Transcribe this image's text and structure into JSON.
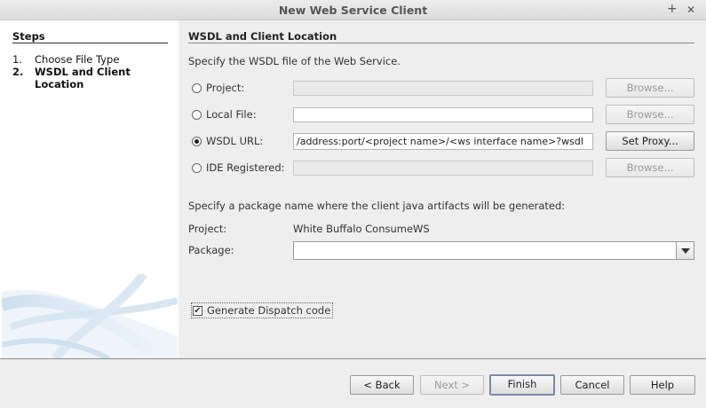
{
  "window": {
    "title": "New Web Service Client",
    "maximize_glyph": "+",
    "close_glyph": "✕"
  },
  "steps": {
    "heading": "Steps",
    "items": [
      {
        "num": "1.",
        "label": "Choose File Type",
        "active": false
      },
      {
        "num": "2.",
        "label": "WSDL and Client Location",
        "active": true
      }
    ]
  },
  "main": {
    "title": "WSDL and Client Location",
    "instruction": "Specify the WSDL file of the Web Service.",
    "options": [
      {
        "label": "Project:",
        "checked": false,
        "value": "",
        "button": "Browse...",
        "field_enabled": false,
        "button_enabled": false
      },
      {
        "label": "Local File:",
        "checked": false,
        "value": "",
        "button": "Browse...",
        "field_enabled": true,
        "button_enabled": false
      },
      {
        "label": "WSDL URL:",
        "checked": true,
        "value": "/address:port/<project name>/<ws interface name>?wsdl",
        "button": "Set Proxy...",
        "field_enabled": true,
        "button_enabled": true
      },
      {
        "label": "IDE Registered:",
        "checked": false,
        "value": "",
        "button": "Browse...",
        "field_enabled": false,
        "button_enabled": false
      }
    ],
    "package_instruction": "Specify a package name where the client java artifacts will be generated:",
    "project_label": "Project:",
    "project_value": "White Buffalo ConsumeWS",
    "package_label": "Package:",
    "package_value": "",
    "dispatch_label": "Generate Dispatch code",
    "dispatch_checked": true,
    "check_glyph": "✔"
  },
  "footer": {
    "back": "< Back",
    "next": "Next >",
    "finish": "Finish",
    "cancel": "Cancel",
    "help": "Help"
  }
}
